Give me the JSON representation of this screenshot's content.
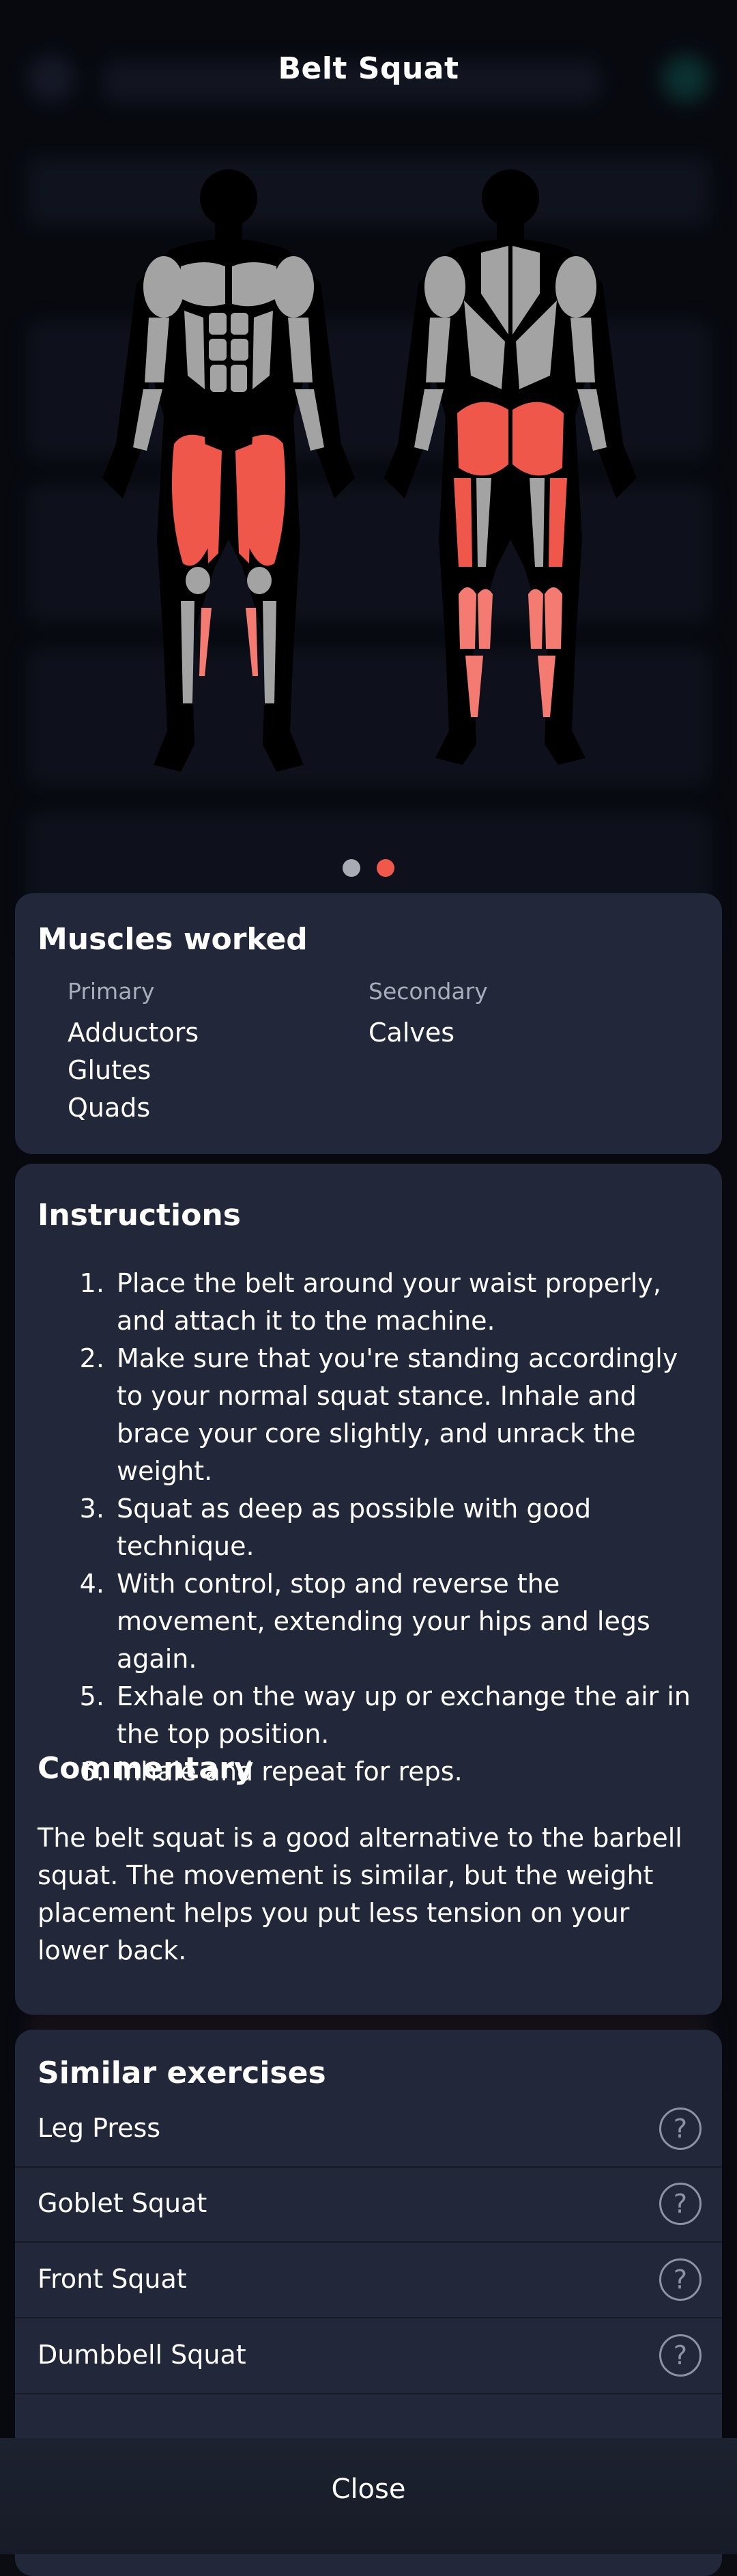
{
  "modal": {
    "title": "Belt Squat"
  },
  "figures": {
    "front_view": "front-body-icon",
    "back_view": "back-body-icon",
    "highlight_color": "#f0574b",
    "secondary_color": "#f47b72",
    "muscle_base_color": "#a3a3a3"
  },
  "pager": {
    "total": 2,
    "active_index": 2
  },
  "muscles": {
    "heading": "Muscles worked",
    "primary_label": "Primary",
    "primary": [
      "Adductors",
      "Glutes",
      "Quads"
    ],
    "secondary_label": "Secondary",
    "secondary": [
      "Calves"
    ]
  },
  "instructions": {
    "heading": "Instructions",
    "steps": [
      "Place the belt around your waist properly, and attach it to the machine.",
      "Make sure that you're standing accordingly to your normal squat stance. Inhale and brace your core slightly, and unrack the weight.",
      "Squat as deep as possible with good technique.",
      "With control, stop and reverse the movement, extending your hips and legs again.",
      "Exhale on the way up or exchange the air in the top position.",
      "Inhale and repeat for reps."
    ]
  },
  "commentary": {
    "heading": "Commentary",
    "text": "The belt squat is a good alternative to the barbell squat. The movement is similar, but the weight placement helps you put less tension on your lower back."
  },
  "similar": {
    "heading": "Similar exercises",
    "items": [
      "Leg Press",
      "Goblet Squat",
      "Front Squat",
      "Dumbbell Squat"
    ],
    "help_glyph": "?"
  },
  "footer": {
    "close_label": "Close"
  },
  "colors": {
    "card_bg": "#222839",
    "accent": "#f0584c",
    "page_bg": "#0b0d13"
  }
}
